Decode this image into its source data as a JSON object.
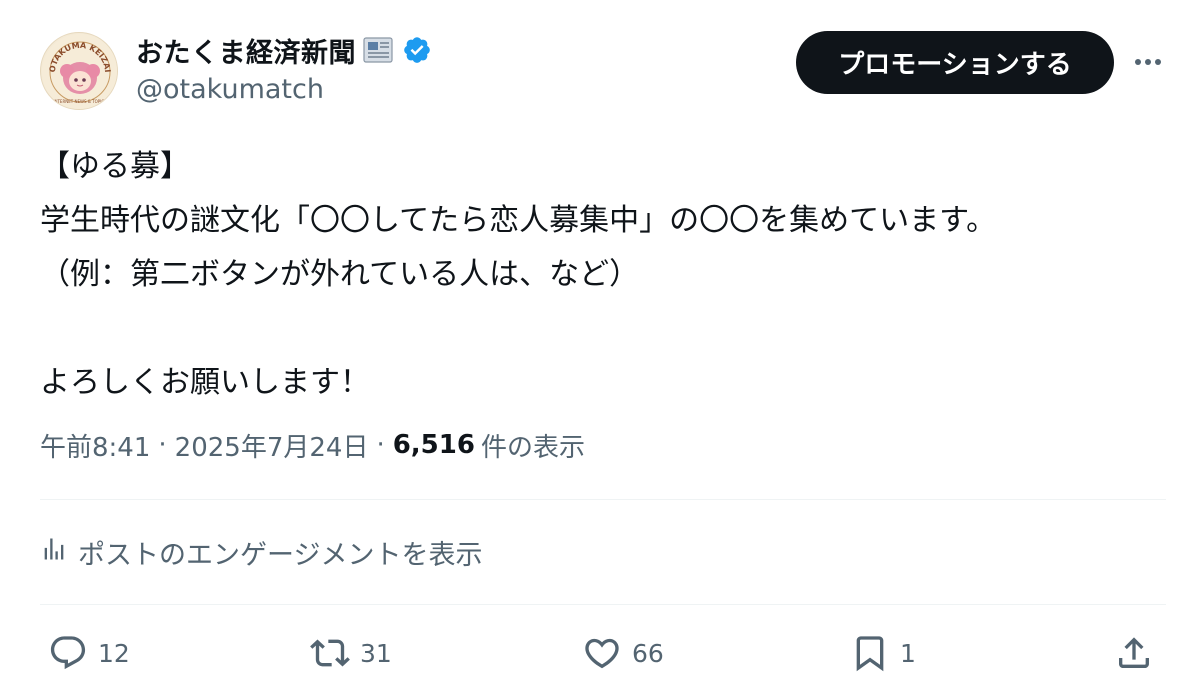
{
  "author": {
    "display_name": "おたくま経済新聞",
    "handle": "@otakumatch",
    "avatar_arc_text": "OTAKUMA KEIZAI",
    "avatar_bottom_text": "INTERNET NEWS & TOPICS",
    "verified_color": "#1d9bf0"
  },
  "header": {
    "promote_label": "プロモーションする",
    "more_icon": "more-horizontal-icon"
  },
  "tweet": {
    "lines": [
      "【ゆる募】",
      "学生時代の謎文化「〇〇してたら恋人募集中」の〇〇を集めています。",
      "（例：第二ボタンが外れている人は、など）",
      "",
      "よろしくお願いします！"
    ]
  },
  "meta": {
    "time": "午前8:41",
    "date": "2025年7月24日",
    "separator": "·",
    "views_count": "6,516",
    "views_suffix": "件の表示"
  },
  "engagement": {
    "label": "ポストのエンゲージメントを表示",
    "icon": "analytics-icon"
  },
  "actions": {
    "reply_count": "12",
    "repost_count": "31",
    "like_count": "66",
    "bookmark_count": "1"
  },
  "colors": {
    "text_primary": "#0f1419",
    "text_secondary": "#536471",
    "button_bg": "#0f1419",
    "divider": "#eff3f4"
  }
}
